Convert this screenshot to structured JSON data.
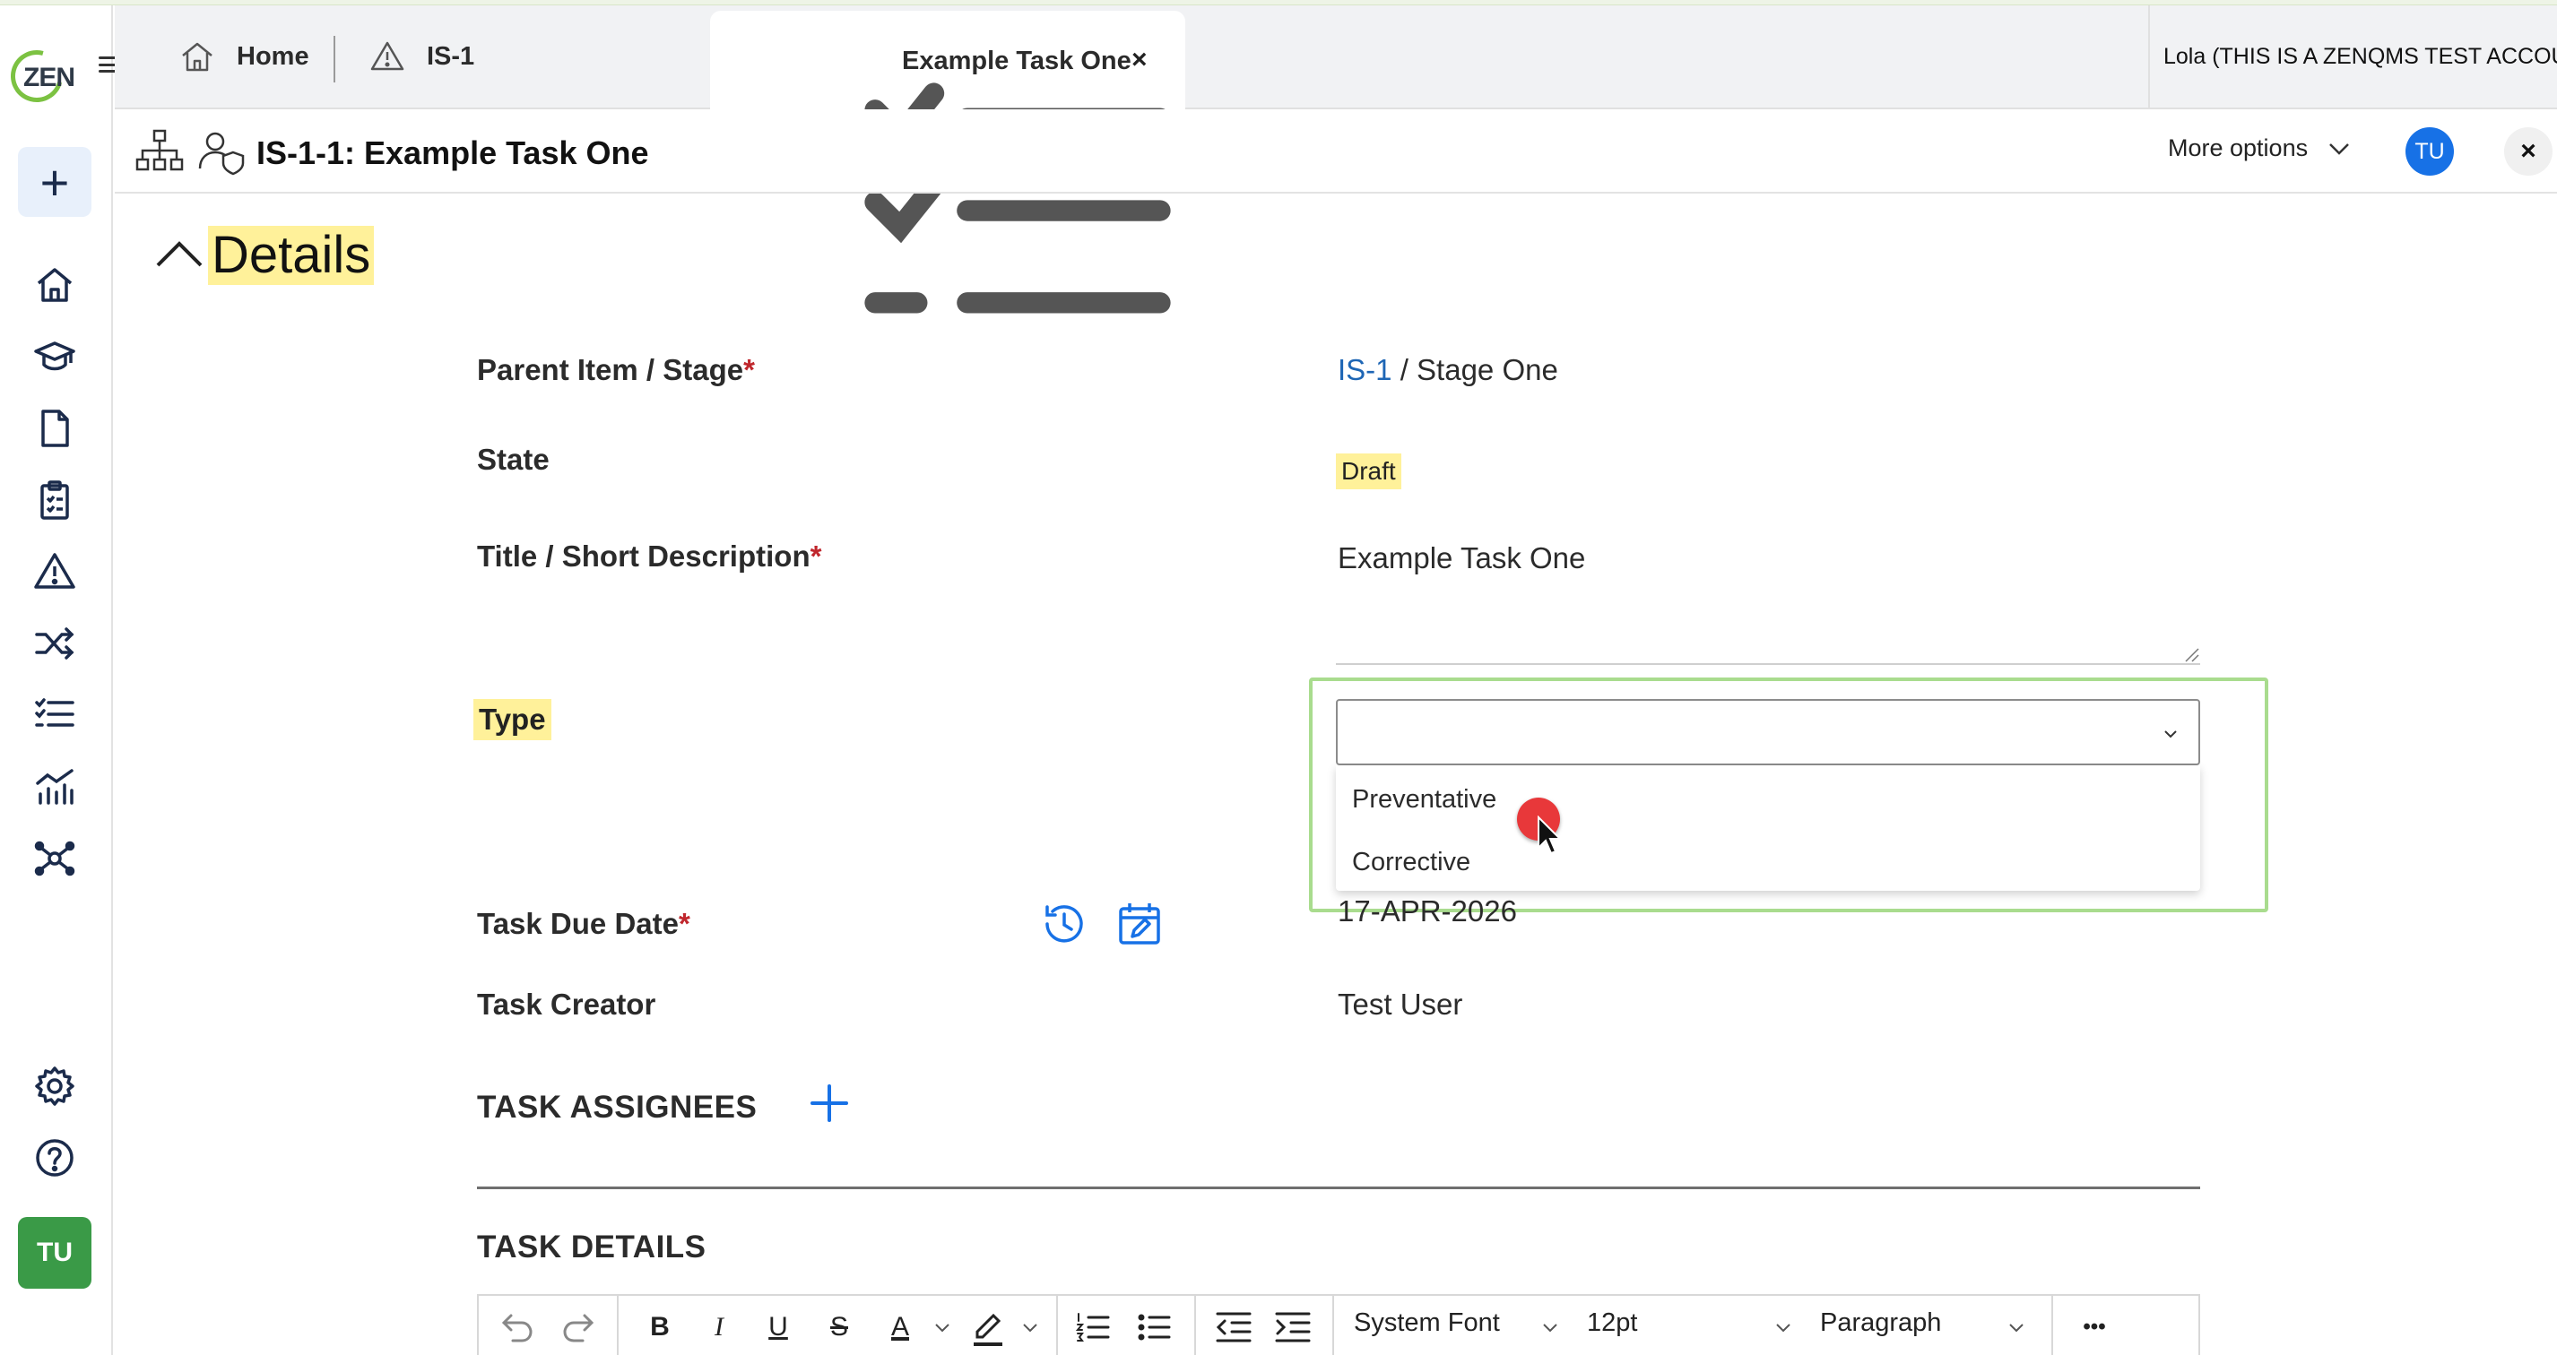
{
  "app": {
    "logo_text": "ZEN"
  },
  "tabs": {
    "home": "Home",
    "is1": "IS-1",
    "active": "Example Task One",
    "close_glyph": "×"
  },
  "account": {
    "name": "Lola (THIS IS A ZENQMS TEST ACCOUNT"
  },
  "header": {
    "title": "IS-1-1: Example Task One",
    "more_options": "More options",
    "user_initials": "TU",
    "close_glyph": "×"
  },
  "sidebar": {
    "add_glyph": "+",
    "user_initials": "TU",
    "icons": [
      "home-icon",
      "training-icon",
      "document-icon",
      "clipboard-icon",
      "warning-icon",
      "shuffle-icon",
      "checklist-icon",
      "analytics-icon",
      "network-icon",
      "gear-icon",
      "help-icon"
    ]
  },
  "section": {
    "title": "Details"
  },
  "fields": {
    "parent": {
      "label": "Parent Item / Stage",
      "required": "*",
      "link": "IS-1",
      "value": " / Stage One"
    },
    "state": {
      "label": "State",
      "value": "Draft"
    },
    "title": {
      "label": "Title / Short Description",
      "required": "*",
      "value": "Example Task One"
    },
    "type": {
      "label": "Type",
      "selected": "",
      "options": [
        "Preventative",
        "Corrective"
      ]
    },
    "due": {
      "label": "Task Due Date",
      "required": "*",
      "value": "17-APR-2026"
    },
    "creator": {
      "label": "Task Creator",
      "value": "Test User"
    }
  },
  "assignees": {
    "heading": "TASK ASSIGNEES"
  },
  "details": {
    "heading": "TASK DETAILS"
  },
  "editor": {
    "font": "System Font",
    "size": "12pt",
    "block": "Paragraph",
    "bold": "B",
    "italic": "I",
    "underline": "U",
    "strike": "S",
    "font_color": "A",
    "more": "•••"
  },
  "colors": {
    "accent_blue": "#1771e6",
    "link_blue": "#1e66b5",
    "highlight_yellow": "#fff19a",
    "focus_green": "#a9dc8e",
    "user_green": "#3a9a47",
    "required_red": "#c0272d"
  }
}
